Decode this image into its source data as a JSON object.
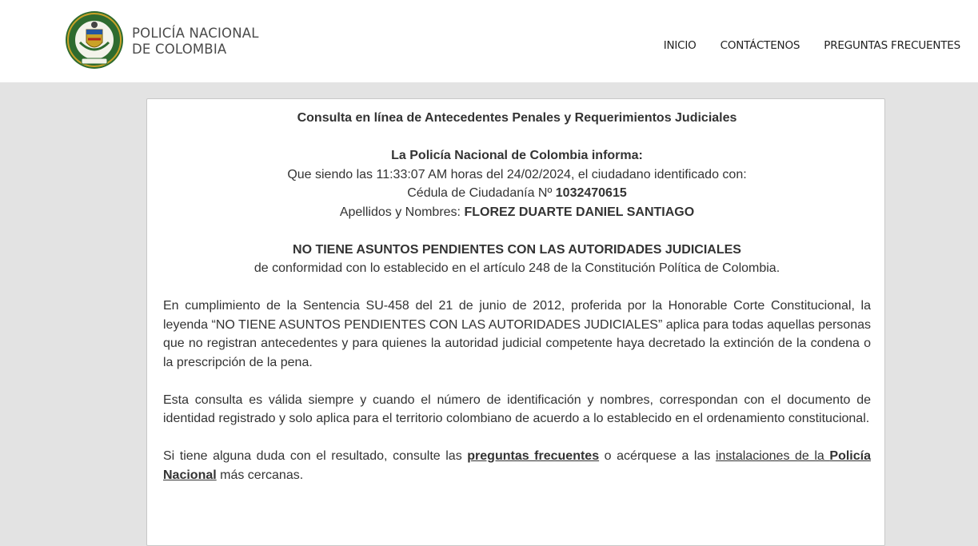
{
  "header": {
    "brand_line1": "POLICÍA NACIONAL",
    "brand_line2": "DE COLOMBIA",
    "nav": [
      "INICIO",
      "CONTÁCTENOS",
      "PREGUNTAS FRECUENTES"
    ]
  },
  "card": {
    "title": "Consulta en línea de Antecedentes Penales y Requerimientos Judiciales",
    "informa": "La Policía Nacional de Colombia informa:",
    "line_time_pre": "Que siendo las ",
    "time": "11:33:07 AM",
    "line_time_mid": " horas del ",
    "date": "24/02/2024",
    "line_time_post": ", el ciudadano identificado con:",
    "cedula_label": "Cédula de Ciudadanía Nº ",
    "cedula_number": "1032470615",
    "names_label": "Apellidos y Nombres: ",
    "names_value": "FLOREZ DUARTE DANIEL SANTIAGO",
    "status": "NO TIENE ASUNTOS PENDIENTES CON LAS AUTORIDADES JUDICIALES",
    "status_sub": "de conformidad con lo establecido en el artículo 248 de la Constitución Política de Colombia.",
    "para1": "En cumplimiento de la Sentencia SU-458 del 21 de junio de 2012, proferida por la Honorable Corte Constitucional, la leyenda “NO TIENE ASUNTOS PENDIENTES CON LAS AUTORIDADES JUDICIALES” aplica para todas aquellas personas que no registran antecedentes y para quienes la autoridad judicial competente haya decretado la extinción de la condena o la prescripción de la pena.",
    "para2": "Esta consulta es válida siempre y cuando el número de identificación y nombres, correspondan con el documento de identidad registrado y solo aplica para el territorio colombiano de acuerdo a lo establecido en el ordenamiento constitucional.",
    "para3_pre": "Si tiene alguna duda con el resultado, consulte las ",
    "para3_link1": "preguntas frecuentes",
    "para3_mid": " o acérquese a las ",
    "para3_link2_plain": "instalaciones de la ",
    "para3_link2_bold": "Policía Nacional",
    "para3_post": " más cercanas."
  },
  "colors": {
    "header_bg": "#ffffff",
    "page_bg": "#e3e3e3",
    "emblem_green": "#2e6b2f",
    "emblem_gold": "#c9a227"
  }
}
